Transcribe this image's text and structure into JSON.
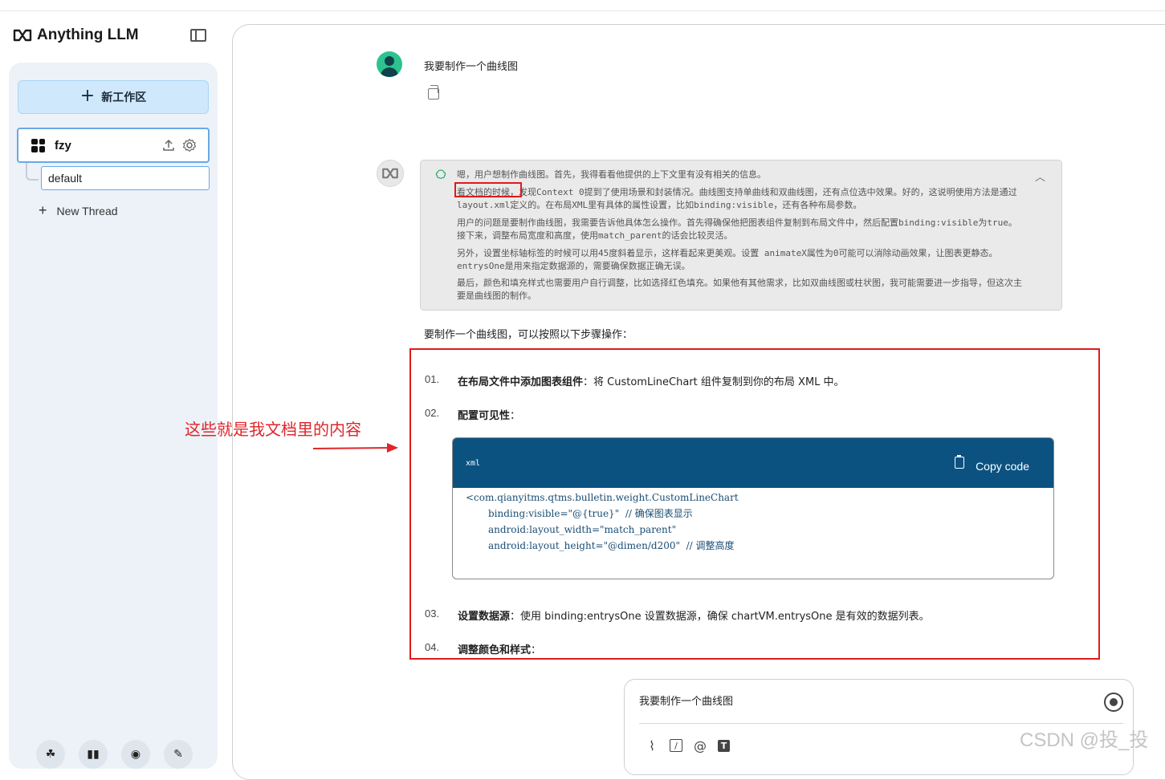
{
  "app": {
    "name": "Anything LLM"
  },
  "sidebar": {
    "new_workspace_label": "新工作区",
    "workspace": {
      "name": "fzy"
    },
    "threads": [
      {
        "label": "default"
      }
    ],
    "new_thread_label": "New Thread",
    "footer_icons": [
      "community-icon",
      "docs-icon",
      "discord-icon",
      "settings-wrench-icon"
    ]
  },
  "chat": {
    "user_message": "我要制作一个曲线图",
    "thought": {
      "p1": "嗯，用户想制作曲线图。首先，我得看看他提供的上下文里有没有相关的信息。",
      "p2_highlight": "看文档的时候，",
      "p2_rest": "发现Context 0提到了使用场景和封装情况。曲线图支持单曲线和双曲线图，还有点位选中效果。好的，这说明使用方法是通过layout.xml定义的。在布局XML里有具体的属性设置，比如binding:visible，还有各种布局参数。",
      "p3": "用户的问题是要制作曲线图，我需要告诉他具体怎么操作。首先得确保他把图表组件复制到布局文件中，然后配置binding:visible为true。接下来，调整布局宽度和高度，使用match_parent的话会比较灵活。",
      "p4": "另外，设置坐标轴标签的时候可以用45度斜着显示，这样看起来更美观。设置 animateX属性为0可能可以消除动画效果，让图表更静态。entrysOne是用来指定数据源的，需要确保数据正确无误。",
      "p5": "最后，颜色和填充样式也需要用户自行调整，比如选择红色填充。如果他有其他需求，比如双曲线图或柱状图，我可能需要进一步指导，但这次主要是曲线图的制作。"
    },
    "intro": "要制作一个曲线图，可以按照以下步骤操作：",
    "steps": [
      {
        "num": "01.",
        "title": "在布局文件中添加图表组件",
        "text": "：将 CustomLineChart 组件复制到你的布局 XML 中。"
      },
      {
        "num": "02.",
        "title": "配置可见性",
        "text": "："
      },
      {
        "num": "03.",
        "title": "设置数据源",
        "text": "：使用 binding:entrysOne 设置数据源，确保 chartVM.entrysOne 是有效的数据列表。"
      },
      {
        "num": "04.",
        "title": "调整颜色和样式",
        "text": "："
      }
    ],
    "code": {
      "lang": "xml",
      "copy_label": "Copy code",
      "line1": "<com.qianyitms.qtms.bulletin.weight.CustomLineChart",
      "line2": "binding:visible=\"@{true}\"  ",
      "line2_comment": "// 确保图表显示",
      "line3": "android:layout_width=\"match_parent\"",
      "line4": "android:layout_height=\"@dimen/d200\"  ",
      "line4_comment": "// 调整高度"
    }
  },
  "annotation": {
    "text": "这些就是我文档里的内容",
    "color": "#e0262a"
  },
  "input": {
    "value": "我要制作一个曲线图"
  },
  "watermark": "CSDN @投_投",
  "colors": {
    "accent": "#0b5281",
    "highlight_box": "#e01a1a",
    "new_ws_bg": "#cfe8fb"
  }
}
